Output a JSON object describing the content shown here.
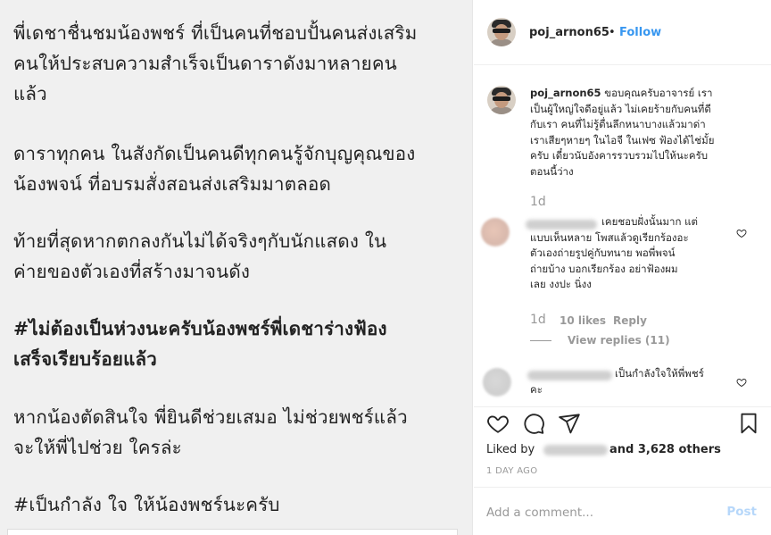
{
  "post": {
    "caption_paragraphs": [
      [
        "พี่เดชาชื่นชมน้องพชร์ ที่เป็นคนที่ชอบปั้นคนส่งเสริม",
        "คนให้ประสบความสำเร็จเป็นดาราดังมาหลายคน",
        "แล้ว"
      ],
      [
        " ดาราทุกคน ในสังกัดเป็นคนดีทุกคนรู้จักบุญคุณของ",
        "น้องพจน์ ที่อบรมสั่งสอนส่งเสริมมาตลอด"
      ],
      [
        "ท้ายที่สุดหากตกลงกันไม่ได้จริงๆกับนักแสดง ใน",
        "ค่ายของตัวเองที่สร้างมาจนดัง"
      ],
      [
        "#ไม่ต้องเป็นห่วงนะครับน้องพชร์พี่เดชาร่างฟ้อง",
        "เสร็จเรียบร้อยแล้ว"
      ],
      [
        "หากน้องตัดสินใจ พี่ยินดีช่วยเสมอ ไม่ช่วยพชร์แล้ว",
        "จะให้พี่ไปช่วย ใครล่ะ"
      ],
      [
        "#เป็นกำลัง ใจ ให้น้องพชร์นะครับ"
      ]
    ]
  },
  "header": {
    "username": "poj_arnon65",
    "separator": "•",
    "follow_label": "Follow"
  },
  "comments": [
    {
      "username": "poj_arnon65",
      "lines": [
        "ขอบคุณครับอาจารย์ เรา",
        "เป็นผู้ใหญ่ใจดีอยู่แล้ว ไม่เคยร้ายกับคนที่ดี",
        "กับเรา คนที่ไม่รู้ตื่นลึกหนาบางแล้วมาด่า",
        "เราเสียๆหายๆ ในไอจี ในเฟซ ฟ้องได้ไช่มั้ย",
        "ครับ เดี๋ยวนับอังคารรวบรวมไปให้นะครับ",
        "ตอนนี้ว่าง"
      ],
      "time": "1d"
    },
    {
      "lines": [
        "เคยชอบฝั่งนั้นมาก แต่",
        "แบบเห็นหลาย โพสแล้วดูเรียกร้องอะ",
        "ตัวเองถ่ายรูปคู่กับทนาย พอพี่พจน์",
        "ถ่ายบ้าง บอกเรียกร้อง อย่าฟ้องผม",
        "เลย งงปะ นิ่งง"
      ],
      "time": "1d",
      "likes": "10 likes",
      "reply": "Reply",
      "view_replies": "View replies (11)"
    },
    {
      "lines": [
        "เป็นกำลังใจให้พี่พชร์",
        "คะ"
      ]
    }
  ],
  "actions": {
    "liked_by_prefix": "Liked by",
    "liked_by_suffix": "and 3,628 others",
    "date": "1 DAY AGO"
  },
  "add_comment": {
    "placeholder": "Add a comment...",
    "post_label": "Post"
  },
  "colors": {
    "follow": "#3897f0",
    "post_disabled": "#b6d7fa",
    "muted": "#999999"
  }
}
